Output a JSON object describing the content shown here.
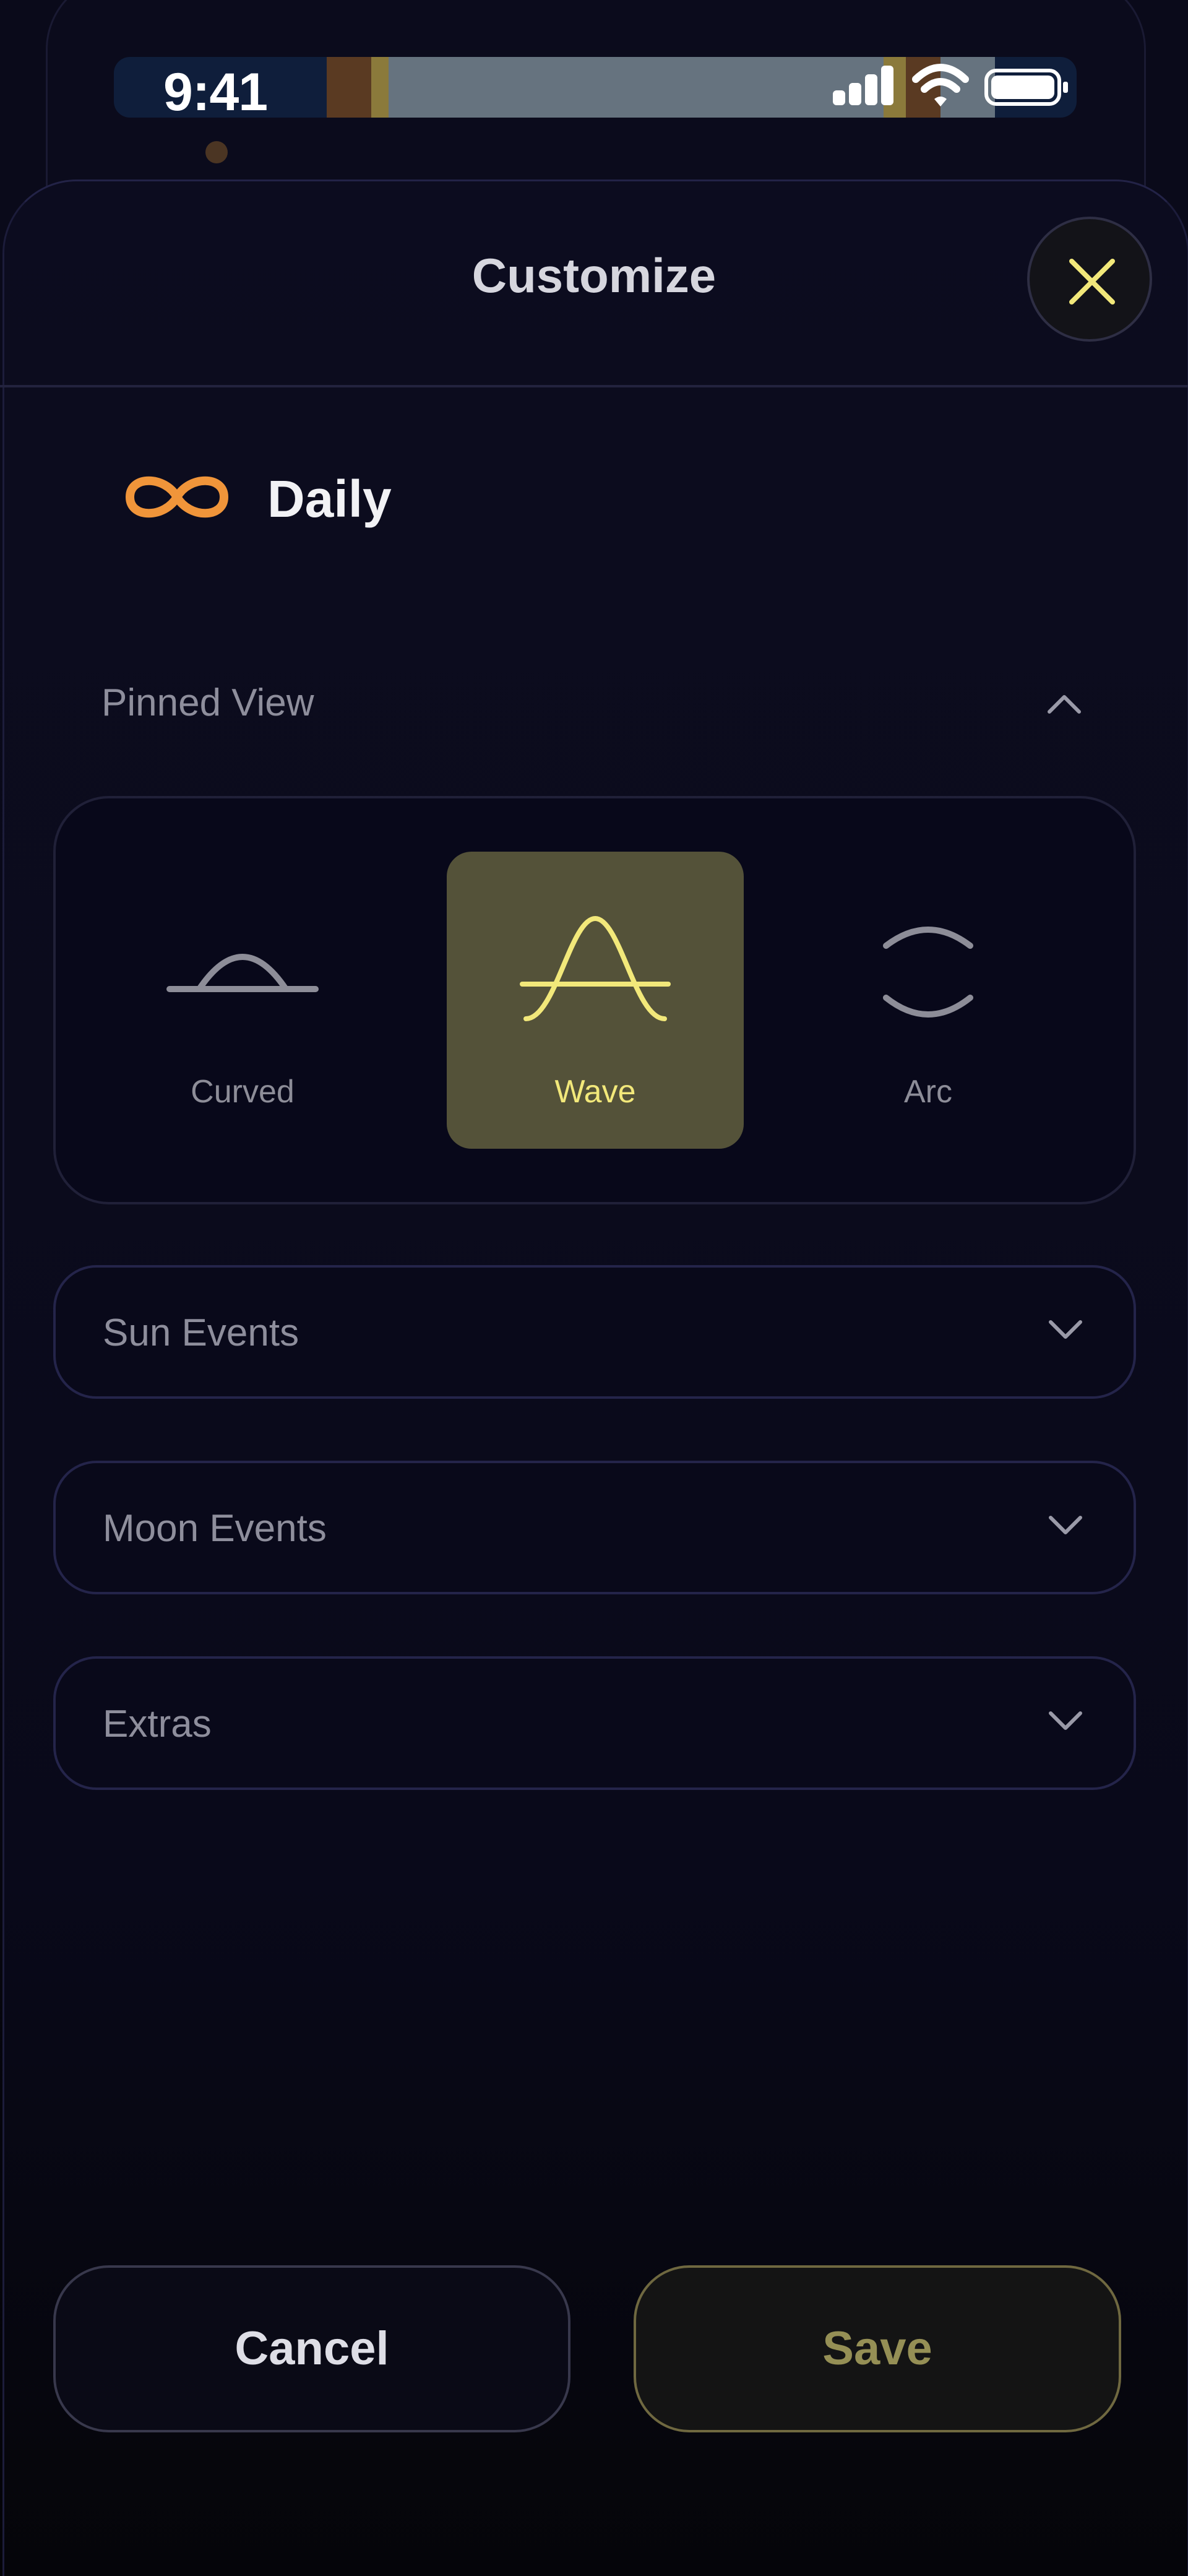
{
  "status_bar": {
    "time": "9:41",
    "icons": [
      "cellular-signal-icon",
      "wifi-icon",
      "battery-icon"
    ]
  },
  "sheet": {
    "title": "Customize",
    "close_icon": "close-icon"
  },
  "preset": {
    "icon": "infinity-icon",
    "label": "Daily"
  },
  "pinned_view": {
    "label": "Pinned View",
    "expanded": true,
    "options": [
      {
        "label": "Curved",
        "icon": "curved-icon",
        "selected": false
      },
      {
        "label": "Wave",
        "icon": "wave-icon",
        "selected": true
      },
      {
        "label": "Arc",
        "icon": "arc-icon",
        "selected": false
      }
    ]
  },
  "sections": [
    {
      "label": "Sun Events",
      "expanded": false
    },
    {
      "label": "Moon Events",
      "expanded": false
    },
    {
      "label": "Extras",
      "expanded": false
    }
  ],
  "footer": {
    "cancel_label": "Cancel",
    "save_label": "Save"
  },
  "colors": {
    "accent_yellow": "#f2e87a",
    "accent_orange": "#f0953a",
    "selected_bg": "#545239",
    "background": "#0a0a1a"
  }
}
